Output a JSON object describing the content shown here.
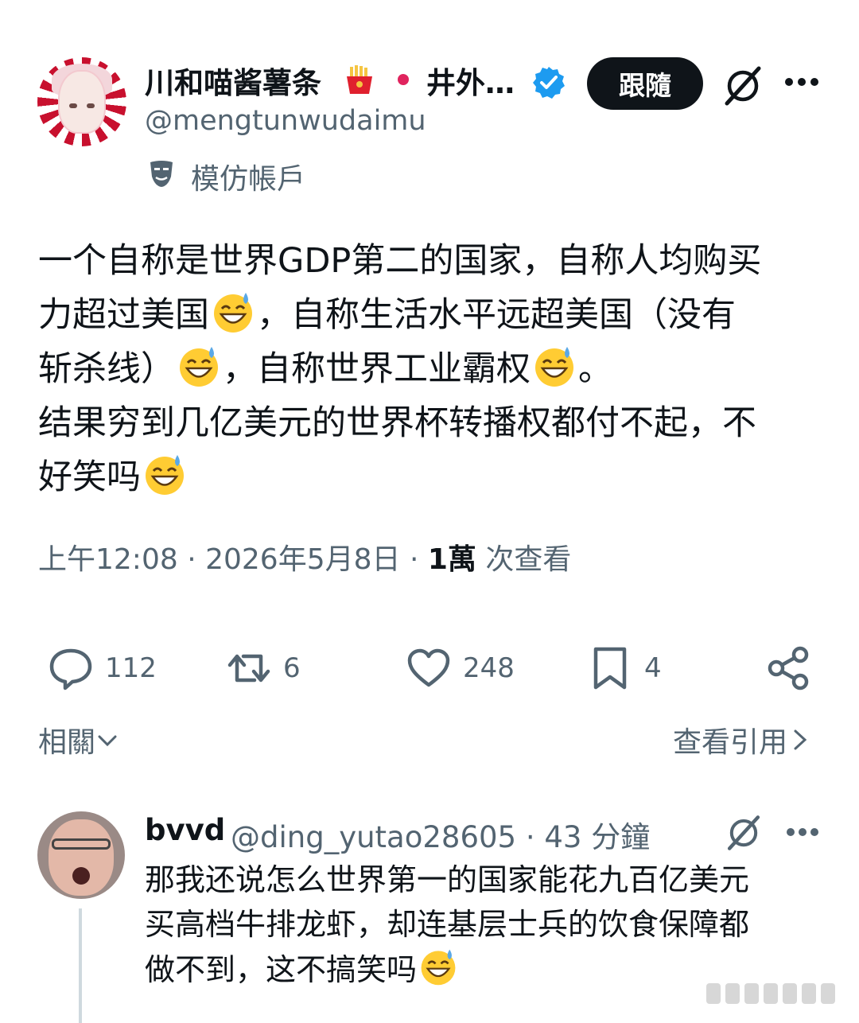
{
  "tweet": {
    "author": {
      "display_name": "川和喵酱薯条",
      "display_name_rest": "井外…",
      "handle": "@mengtunwudaimu",
      "parody_label": "模仿帳戶"
    },
    "follow_label": "跟隨",
    "text_lines": [
      [
        "一个自称是世界GDP第二的国家，自称人均购买"
      ],
      [
        "力超过美国",
        "，自称生活水平远超美国（没有"
      ],
      [
        "斩杀线）",
        "，自称世界工业霸权",
        "。"
      ],
      [
        "结果穷到几亿美元的世界杯转播权都付不起，不"
      ],
      [
        "好笑吗",
        ""
      ]
    ],
    "meta": {
      "time": "上午12:08",
      "sep1": " · ",
      "date": "2026年5月8日",
      "sep2": " · ",
      "views_count": "1萬",
      "views_label": " 次查看"
    },
    "actions": {
      "replies": "112",
      "reposts": "6",
      "likes": "248",
      "bookmarks": "4"
    },
    "related_label": "相關",
    "view_quotes_label": "查看引用"
  },
  "reply": {
    "display_name": "bvvd",
    "handle_time": "@ding_yutao28605 · 43 分鐘",
    "text_lines": [
      [
        "那我还说怎么世界第一的国家能花九百亿美元"
      ],
      [
        "买高档牛排龙虾，却连基层士兵的饮食保障都"
      ],
      [
        "做不到，这不搞笑吗",
        ""
      ]
    ]
  },
  "icons": {
    "verified": "verified-badge-icon",
    "fries": "french-fries-emoji",
    "emoji": "grinning-sweat-emoji",
    "parody": "theater-mask-icon",
    "grok": "grok-icon",
    "more": "more-dots-icon",
    "reply": "reply-icon",
    "repost": "repost-icon",
    "like": "heart-icon",
    "bookmark": "bookmark-icon",
    "share": "share-icon"
  },
  "colors": {
    "text": "#0f1419",
    "secondary": "#536471",
    "verified": "#1d9bf0",
    "follow_bg": "#0f1419",
    "red_dot": "#e0245e"
  }
}
